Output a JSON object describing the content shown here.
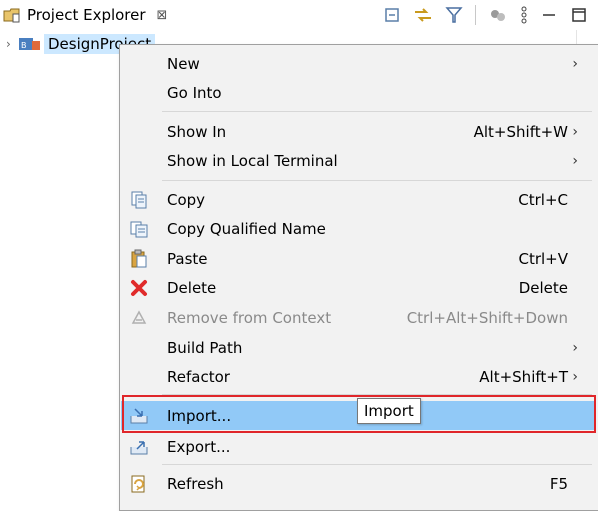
{
  "view": {
    "title": "Project Explorer",
    "close_glyph": "⊠",
    "toolbar_icons": [
      "collapse-all-icon",
      "link-with-editor-icon",
      "filter-icon",
      "focus-task-icon",
      "view-menu-icon",
      "minimize-icon",
      "maximize-icon"
    ]
  },
  "tree": {
    "project_name": "DesignProject"
  },
  "menu": {
    "items": [
      {
        "label": "New",
        "shortcut": "",
        "submenu": true
      },
      {
        "label": "Go Into",
        "shortcut": "",
        "submenu": false
      },
      {
        "label": "Show In",
        "shortcut": "Alt+Shift+W",
        "submenu": true
      },
      {
        "label": "Show in Local Terminal",
        "shortcut": "",
        "submenu": true
      },
      {
        "label": "Copy",
        "shortcut": "Ctrl+C",
        "submenu": false,
        "icon": "copy-icon"
      },
      {
        "label": "Copy Qualified Name",
        "shortcut": "",
        "submenu": false,
        "icon": "copy-qualified-name-icon"
      },
      {
        "label": "Paste",
        "shortcut": "Ctrl+V",
        "submenu": false,
        "icon": "paste-icon"
      },
      {
        "label": "Delete",
        "shortcut": "Delete",
        "submenu": false,
        "icon": "delete-icon"
      },
      {
        "label": "Remove from Context",
        "shortcut": "Ctrl+Alt+Shift+Down",
        "submenu": false,
        "icon": "remove-from-context-icon",
        "disabled": true
      },
      {
        "label": "Build Path",
        "shortcut": "",
        "submenu": true
      },
      {
        "label": "Refactor",
        "shortcut": "Alt+Shift+T",
        "submenu": true
      },
      {
        "label": "Import...",
        "shortcut": "",
        "submenu": false,
        "icon": "import-icon",
        "highlighted": true
      },
      {
        "label": "Export...",
        "shortcut": "",
        "submenu": false,
        "icon": "export-icon"
      },
      {
        "label": "Refresh",
        "shortcut": "F5",
        "submenu": false,
        "icon": "refresh-icon"
      }
    ],
    "submenu_arrow": "›"
  },
  "tooltip": {
    "text": "Import"
  },
  "colors": {
    "highlight": "#91c9f7",
    "selection": "#cce8ff",
    "annotation_border": "#e0262a",
    "menu_bg": "#f2f2f2"
  }
}
